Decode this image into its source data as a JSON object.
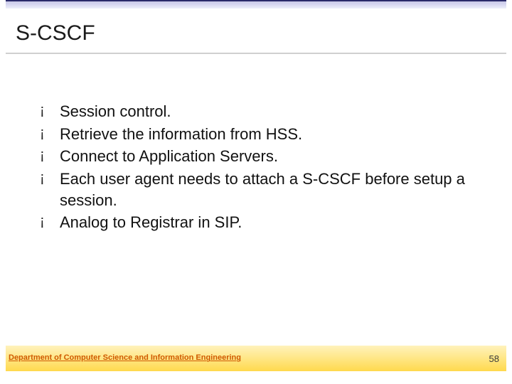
{
  "slide": {
    "title": "S-CSCF",
    "bullets": [
      "Session control.",
      "Retrieve the information from HSS.",
      "Connect to Application Servers.",
      "Each user agent needs to attach a S-CSCF before setup a session.",
      "Analog to Registrar in SIP."
    ]
  },
  "footer": {
    "department": "Department of Computer Science and Information Engineering",
    "page": "58"
  }
}
